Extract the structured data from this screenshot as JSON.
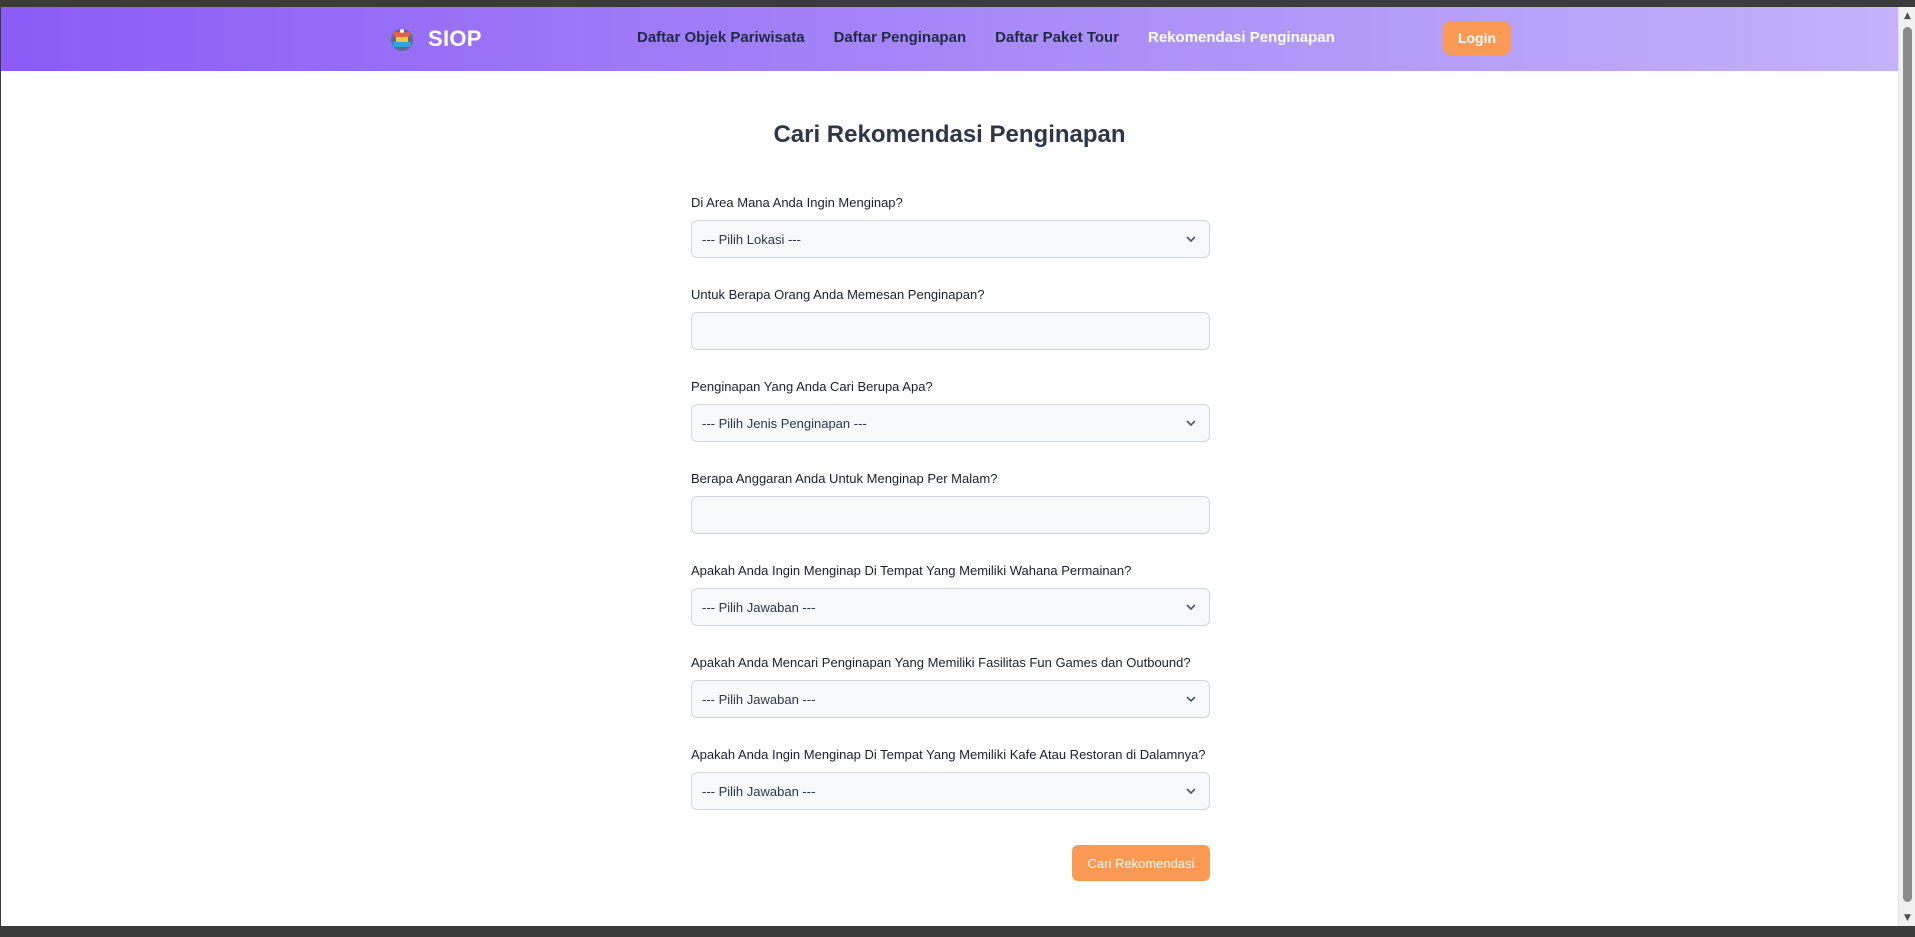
{
  "navbar": {
    "brand": "SIOP",
    "links": [
      "Daftar Objek Pariwisata",
      "Daftar Penginapan",
      "Daftar Paket Tour",
      "Rekomendasi Penginapan"
    ],
    "active_link": "Rekomendasi Penginapan",
    "login_label": "Login"
  },
  "page": {
    "title": "Cari Rekomendasi Penginapan"
  },
  "form": {
    "location": {
      "label": "Di Area Mana Anda Ingin Menginap?",
      "selected": "--- Pilih Lokasi ---"
    },
    "guests": {
      "label": "Untuk Berapa Orang Anda Memesan Penginapan?",
      "value": ""
    },
    "type": {
      "label": "Penginapan Yang Anda Cari Berupa Apa?",
      "selected": "--- Pilih Jenis Penginapan ---"
    },
    "budget": {
      "label": "Berapa Anggaran Anda Untuk Menginap Per Malam?",
      "value": ""
    },
    "rides": {
      "label": "Apakah Anda Ingin Menginap Di Tempat Yang Memiliki Wahana Permainan?",
      "selected": "--- Pilih Jawaban ---"
    },
    "fungames": {
      "label": "Apakah Anda Mencari Penginapan Yang Memiliki Fasilitas Fun Games dan Outbound?",
      "selected": "--- Pilih Jawaban ---"
    },
    "cafe": {
      "label": "Apakah Anda Ingin Menginap Di Tempat Yang Memiliki Kafe Atau Restoran di Dalamnya?",
      "selected": "--- Pilih Jawaban ---"
    },
    "submit_label": "Cari Rekomendasi"
  },
  "colors": {
    "navbar_start": "#8b5cf6",
    "navbar_end": "#c4b2fb",
    "accent": "#fb9a55",
    "title": "#2d3748"
  },
  "icons": {
    "logo": "siop-logo-icon",
    "select_arrow": "chevron-down-icon"
  }
}
